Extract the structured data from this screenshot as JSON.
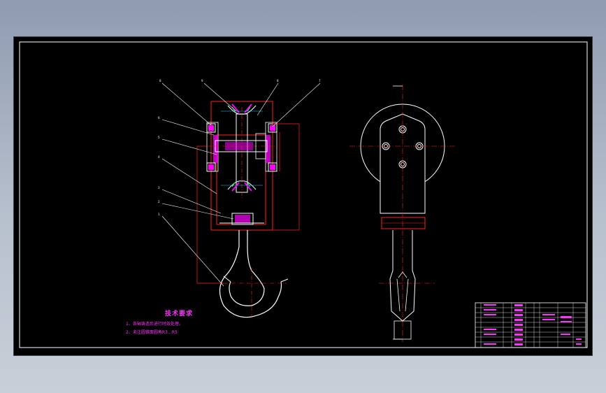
{
  "drawing": {
    "tech_requirements": {
      "title": "技术要求",
      "notes": [
        "1、各轴铸造后进行时效处理。",
        "2、未注圆锥面圆角R3…R5"
      ]
    },
    "leader_numbers": [
      "8",
      "9",
      "8",
      "7",
      "6",
      "5",
      "4",
      "3",
      "2",
      "1"
    ],
    "colors": {
      "background": "#000000",
      "frame": "#ffffff",
      "part_outline": "#ff2020",
      "centerline": "#ff2020",
      "section_fill": "#ff00ff",
      "annotation": "#ff33ff",
      "dimension": "#ff2020",
      "green": "#33ff66",
      "cyan": "#33ccff"
    }
  }
}
